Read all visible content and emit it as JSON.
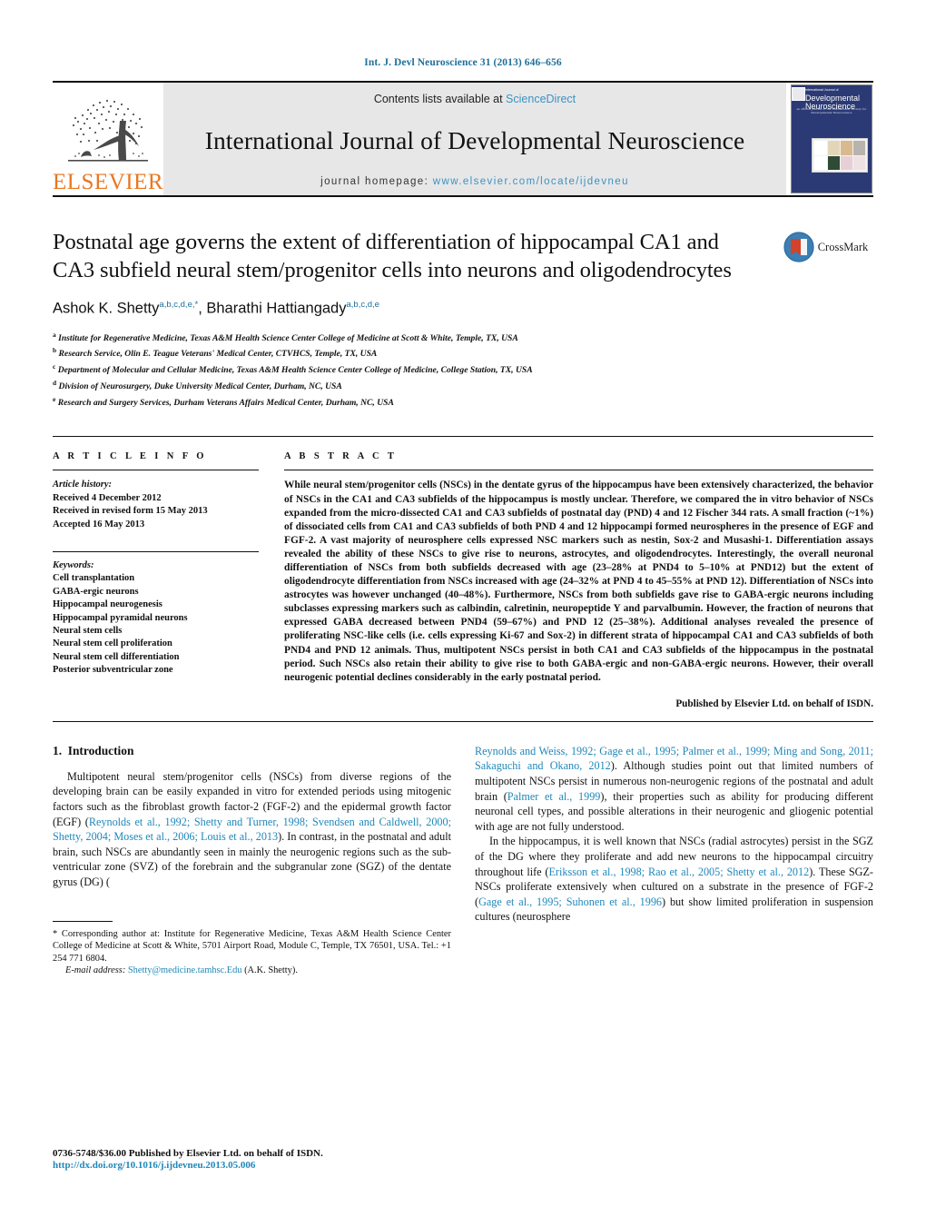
{
  "running_head": "Int. J. Devl Neuroscience 31 (2013) 646–656",
  "masthead": {
    "contents_prefix": "Contents lists available at ",
    "sciencedirect": "ScienceDirect",
    "journal_title": "International Journal of Developmental Neuroscience",
    "homepage_label": "journal homepage:",
    "homepage_url": "www.elsevier.com/locate/ijdevneu",
    "publisher_logo_text": "ELSEVIER",
    "cover": {
      "line1": "Developmental",
      "line2": "Neuroscience",
      "kicker": "International Journal of",
      "strapline": "an official journal of the International Society for Developmental Neuroscience"
    }
  },
  "article": {
    "title": "Postnatal age governs the extent of differentiation of hippocampal CA1 and CA3 subfield neural stem/progenitor cells into neurons and oligodendrocytes",
    "crossmark_label": "CrossMark",
    "authors": [
      {
        "name": "Ashok K. Shetty",
        "sup": "a,b,c,d,e,"
      },
      {
        "name": "Bharathi Hattiangady",
        "sup": "a,b,c,d,e"
      }
    ],
    "affiliations": [
      {
        "mark": "a",
        "text": "Institute for Regenerative Medicine, Texas A&M Health Science Center College of Medicine at Scott & White, Temple, TX, USA"
      },
      {
        "mark": "b",
        "text": "Research Service, Olin E. Teague Veterans' Medical Center, CTVHCS, Temple, TX, USA"
      },
      {
        "mark": "c",
        "text": "Department of Molecular and Cellular Medicine, Texas A&M Health Science Center College of Medicine, College Station, TX, USA"
      },
      {
        "mark": "d",
        "text": "Division of Neurosurgery, Duke University Medical Center, Durham, NC, USA"
      },
      {
        "mark": "e",
        "text": "Research and Surgery Services, Durham Veterans Affairs Medical Center, Durham, NC, USA"
      }
    ]
  },
  "article_info": {
    "heading": "A R T I C L E    I N F O",
    "history_label": "Article history:",
    "history": [
      "Received 4 December 2012",
      "Received in revised form 15 May 2013",
      "Accepted 16 May 2013"
    ],
    "keywords_label": "Keywords:",
    "keywords": [
      "Cell transplantation",
      "GABA-ergic neurons",
      "Hippocampal neurogenesis",
      "Hippocampal pyramidal neurons",
      "Neural stem cells",
      "Neural stem cell proliferation",
      "Neural stem cell differentiation",
      "Posterior subventricular zone"
    ]
  },
  "abstract": {
    "heading": "A B S T R A C T",
    "text": "While neural stem/progenitor cells (NSCs) in the dentate gyrus of the hippocampus have been extensively characterized, the behavior of NSCs in the CA1 and CA3 subfields of the hippocampus is mostly unclear. Therefore, we compared the in vitro behavior of NSCs expanded from the micro-dissected CA1 and CA3 subfields of postnatal day (PND) 4 and 12 Fischer 344 rats. A small fraction (~1%) of dissociated cells from CA1 and CA3 subfields of both PND 4 and 12 hippocampi formed neurospheres in the presence of EGF and FGF-2. A vast majority of neurosphere cells expressed NSC markers such as nestin, Sox-2 and Musashi-1. Differentiation assays revealed the ability of these NSCs to give rise to neurons, astrocytes, and oligodendrocytes. Interestingly, the overall neuronal differentiation of NSCs from both subfields decreased with age (23–28% at PND4 to 5–10% at PND12) but the extent of oligodendrocyte differentiation from NSCs increased with age (24–32% at PND 4 to 45–55% at PND 12). Differentiation of NSCs into astrocytes was however unchanged (40–48%). Furthermore, NSCs from both subfields gave rise to GABA-ergic neurons including subclasses expressing markers such as calbindin, calretinin, neuropeptide Y and parvalbumin. However, the fraction of neurons that expressed GABA decreased between PND4 (59–67%) and PND 12 (25–38%). Additional analyses revealed the presence of proliferating NSC-like cells (i.e. cells expressing Ki-67 and Sox-2) in different strata of hippocampal CA1 and CA3 subfields of both PND4 and PND 12 animals. Thus, multipotent NSCs persist in both CA1 and CA3 subfields of the hippocampus in the postnatal period. Such NSCs also retain their ability to give rise to both GABA-ergic and non-GABA-ergic neurons. However, their overall neurogenic potential declines considerably in the early postnatal period.",
    "published_by": "Published by Elsevier Ltd. on behalf of ISDN."
  },
  "introduction": {
    "section_number": "1.",
    "section_title": "Introduction",
    "para1_a": "Multipotent neural stem/progenitor cells (NSCs) from diverse regions of the developing brain can be easily expanded in vitro for extended periods using mitogenic factors such as the fibroblast growth factor-2 (FGF-2) and the epidermal growth factor (EGF) (",
    "para1_ref1": "Reynolds et al., 1992; Shetty and Turner, 1998; Svendsen and Caldwell, 2000; Shetty, 2004; Moses et al., 2006; Louis et al., 2013",
    "para1_b": "). In contrast, in the postnatal and adult brain, such NSCs are abundantly seen in mainly the neurogenic regions such as the sub-ventricular zone (SVZ) of the forebrain and the subgranular zone (SGZ) of the dentate gyrus (DG) (",
    "para1_ref2": "Reynolds and Weiss, 1992; Gage et al., 1995; Palmer et al., 1999; Ming and Song, 2011; Sakaguchi and Okano, 2012",
    "para1_c": "). Although studies point out that limited numbers of multipotent NSCs persist in numerous non-neurogenic regions of the postnatal and adult brain (",
    "para1_ref3": "Palmer et al., 1999",
    "para1_d": "), their properties such as ability for producing different neuronal cell types, and possible alterations in their neurogenic and gliogenic potential with age are not fully understood.",
    "para2_a": "In the hippocampus, it is well known that NSCs (radial astrocytes) persist in the SGZ of the DG where they proliferate and add new neurons to the hippocampal circuitry throughout life (",
    "para2_ref1": "Eriksson et al., 1998; Rao et al., 2005; Shetty et al., 2012",
    "para2_b": "). These SGZ-NSCs proliferate extensively when cultured on a substrate in the presence of FGF-2 (",
    "para2_ref2": "Gage et al., 1995; Suhonen et al., 1996",
    "para2_c": ") but show limited proliferation in suspension cultures (neurosphere"
  },
  "footnote": {
    "star": "*",
    "corresponding": " Corresponding author at: Institute for Regenerative Medicine, Texas A&M Health Science Center College of Medicine at Scott & White, 5701 Airport Road, Module C, Temple, TX 76501, USA. Tel.: +1 254 771 6804.",
    "email_label": "E-mail address:",
    "email": "Shetty@medicine.tamhsc.Edu",
    "email_suffix": " (A.K. Shetty)."
  },
  "page_footer": {
    "issn_line": "0736-5748/$36.00 Published by Elsevier Ltd. on behalf of ISDN.",
    "doi": "http://dx.doi.org/10.1016/j.ijdevneu.2013.05.006"
  },
  "colors": {
    "link": "#1f87ba",
    "running_head": "#1f6f9a",
    "elsevier_orange": "#E87722",
    "sciencedirect": "#3c93c2"
  }
}
